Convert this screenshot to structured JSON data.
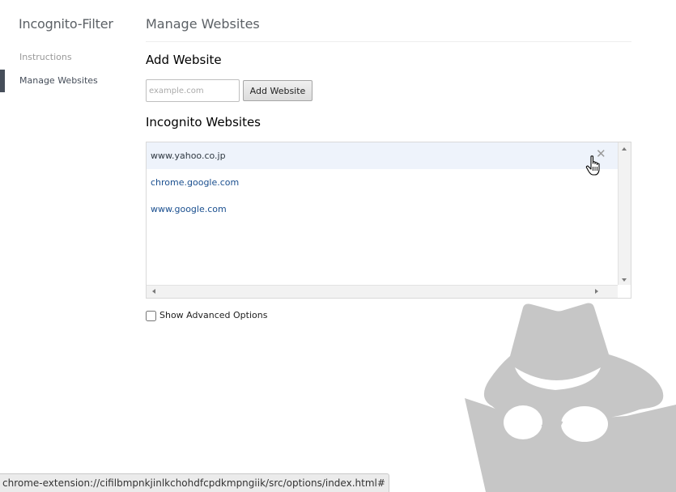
{
  "sidebar": {
    "app_title": "Incognito-Filter",
    "items": [
      {
        "label": "Instructions"
      },
      {
        "label": "Manage Websites"
      }
    ]
  },
  "main": {
    "page_title": "Manage Websites",
    "add_section": {
      "heading": "Add Website",
      "input_placeholder": "example.com",
      "input_value": "",
      "button_label": "Add Website"
    },
    "list_section": {
      "heading": "Incognito Websites",
      "websites": [
        {
          "url": "www.yahoo.co.jp"
        },
        {
          "url": "chrome.google.com"
        },
        {
          "url": "www.google.com"
        }
      ],
      "delete_icon": "✕"
    },
    "advanced_options": {
      "label": "Show Advanced Options",
      "checked": false
    }
  },
  "status_bar": {
    "url": "chrome-extension://cifilbmpnkjinlkchohdfcpdkmpngiik/src/options/index.html#"
  },
  "colors": {
    "selected_row_bg": "#eef3fb",
    "link_blue": "#1a4f8f",
    "nav_selected": "#464e5a",
    "logo_gray": "#c4c4c4"
  },
  "icons": {
    "delete": "close-icon",
    "cursor": "hand-pointer-icon",
    "logo": "incognito-spy-icon"
  }
}
